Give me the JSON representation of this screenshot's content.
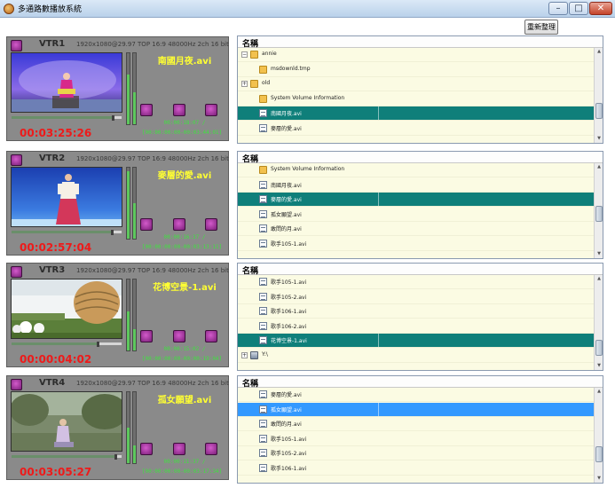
{
  "window": {
    "title": "多通路數播放系統",
    "minimize": "–",
    "maximize": "□",
    "close": "✕"
  },
  "toolbar": {
    "refresh_label": "重新整理"
  },
  "files_header_label": "名稱",
  "colors": {
    "panel_gray": "#8a8a8a",
    "timecode_red": "#ee1a1a",
    "file_yellow": "#ffff33",
    "counter_green": "#3fe23f",
    "selection_teal": "#0f7f7a",
    "selection_blue": "#3399ff",
    "list_background": "#fbfbe3"
  },
  "vtrs": [
    {
      "name": "VTR1",
      "format": "1920x1080@29.97 TOP 16:9 48000Hz 2ch 16 bit",
      "file": "南國月夜.avi",
      "elapsed": "00:00:18:07 /",
      "range": "[00:00:00:00-00:03:44:01]",
      "timecode": "00:03:25:26",
      "progress": 0.92,
      "meter_levels": [
        0.7,
        0.45
      ],
      "scene": "stage"
    },
    {
      "name": "VTR2",
      "format": "1920x1080@29.97 TOP 16:9 48000Hz 2ch 16 bit",
      "file": "麥層的愛.avi",
      "elapsed": "00:00:16:37 /",
      "range": "[00:00:00:00-00:03:13:11]",
      "timecode": "00:02:57:04",
      "progress": 0.91,
      "meter_levels": [
        0.95,
        0.5
      ],
      "scene": "singer"
    },
    {
      "name": "VTR3",
      "format": "1920x1080@29.97 TOP 16:9 48000Hz 2ch 16 bit",
      "file": "花博空景-1.avi",
      "elapsed": "00:00:15:02 /",
      "range": "[00:00:00:00-00:00:19:04]",
      "timecode": "00:00:04:02",
      "progress": 0.78,
      "meter_levels": [
        0.55,
        0.3
      ],
      "scene": "expo"
    },
    {
      "name": "VTR4",
      "format": "1920x1080@29.97 TOP 16:9 48000Hz 2ch 16 bit",
      "file": "孤女願望.avi",
      "elapsed": "00:00:11:37 /",
      "range": "[00:00:00:00-00:03:17:34]",
      "timecode": "00:03:05:27",
      "progress": 0.94,
      "meter_levels": [
        0.5,
        0.25
      ],
      "scene": "garden"
    }
  ],
  "file_lists": [
    {
      "rows": [
        {
          "label": "annie",
          "type": "folder",
          "expander": "⊟",
          "indent": 0
        },
        {
          "label": "msdownld.tmp",
          "type": "folder",
          "expander": "",
          "indent": 1
        },
        {
          "label": "old",
          "type": "folder",
          "expander": "⊞",
          "indent": 0
        },
        {
          "label": "System Volume Information",
          "type": "folder",
          "expander": "",
          "indent": 1
        },
        {
          "label": "南國月夜.avi",
          "type": "file",
          "expander": "",
          "indent": 1,
          "selected": "teal"
        },
        {
          "label": "麥層的愛.avi",
          "type": "file",
          "expander": "",
          "indent": 1
        }
      ],
      "scroll_thumb_position": 0.75
    },
    {
      "rows": [
        {
          "label": "System Volume Information",
          "type": "folder",
          "expander": "",
          "indent": 1
        },
        {
          "label": "南國月夜.avi",
          "type": "file",
          "expander": "",
          "indent": 1
        },
        {
          "label": "麥層的愛.avi",
          "type": "file",
          "expander": "",
          "indent": 1,
          "selected": "teal"
        },
        {
          "label": "孤女願望.avi",
          "type": "file",
          "expander": "",
          "indent": 1
        },
        {
          "label": "敢問的月.avi",
          "type": "file",
          "expander": "",
          "indent": 1
        },
        {
          "label": "歌手105-1.avi",
          "type": "file",
          "expander": "",
          "indent": 1
        }
      ],
      "scroll_thumb_position": 0.55
    },
    {
      "rows": [
        {
          "label": "歌手105-1.avi",
          "type": "file",
          "expander": "",
          "indent": 1
        },
        {
          "label": "歌手105-2.avi",
          "type": "file",
          "expander": "",
          "indent": 1
        },
        {
          "label": "歌手106-1.avi",
          "type": "file",
          "expander": "",
          "indent": 1
        },
        {
          "label": "歌手106-2.avi",
          "type": "file",
          "expander": "",
          "indent": 1
        },
        {
          "label": "花博空景-1.avi",
          "type": "file",
          "expander": "",
          "indent": 1,
          "selected": "teal"
        },
        {
          "label": "Y:\\",
          "type": "drive",
          "expander": "⊞",
          "indent": 0
        }
      ],
      "scroll_thumb_position": 0.9
    },
    {
      "rows": [
        {
          "label": "麥層的愛.avi",
          "type": "file",
          "expander": "",
          "indent": 1
        },
        {
          "label": "孤女願望.avi",
          "type": "file",
          "expander": "",
          "indent": 1,
          "selected": "blue"
        },
        {
          "label": "敢問的月.avi",
          "type": "file",
          "expander": "",
          "indent": 1
        },
        {
          "label": "歌手105-1.avi",
          "type": "file",
          "expander": "",
          "indent": 1
        },
        {
          "label": "歌手105-2.avi",
          "type": "file",
          "expander": "",
          "indent": 1
        },
        {
          "label": "歌手106-1.avi",
          "type": "file",
          "expander": "",
          "indent": 1
        }
      ],
      "scroll_thumb_position": 0.8
    }
  ]
}
